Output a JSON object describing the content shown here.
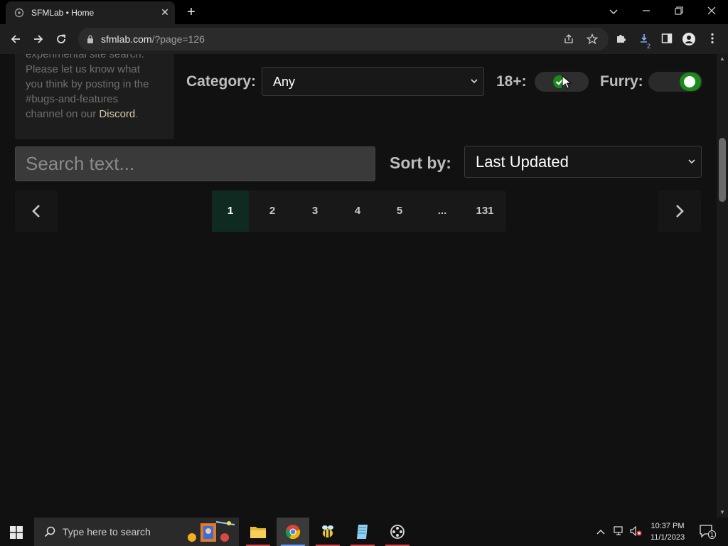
{
  "browser": {
    "tab_title": "SFMLab • Home",
    "tab_close": "✕",
    "new_tab": "+",
    "url_host": "sfmlab.com",
    "url_path": "/?page=126",
    "extension_badge": "2"
  },
  "sidebar_notice": {
    "lines": [
      "experimental site search.",
      "Please let us know what",
      "you think by posting in the",
      "#bugs-and-features"
    ],
    "last_line_prefix": "channel on our ",
    "link_text": "Discord",
    "last_line_suffix": "."
  },
  "filters": {
    "category_label": "Category:",
    "category_value": "Any",
    "adult_label": "18+:",
    "adult_enabled": true,
    "furry_label": "Furry:",
    "furry_enabled": true,
    "toggle_on_color": "#1a8a1a"
  },
  "search": {
    "placeholder": "Search text...",
    "sort_label": "Sort by:",
    "sort_value": "Last Updated"
  },
  "pagination": {
    "prev": "‹",
    "next": "›",
    "pages": [
      "1",
      "2",
      "3",
      "4",
      "5",
      "...",
      "131"
    ],
    "active_page": "1"
  },
  "taskbar": {
    "search_placeholder": "Type here to search",
    "time": "10:37 PM",
    "date": "11/1/2023",
    "notification_count": "1"
  }
}
